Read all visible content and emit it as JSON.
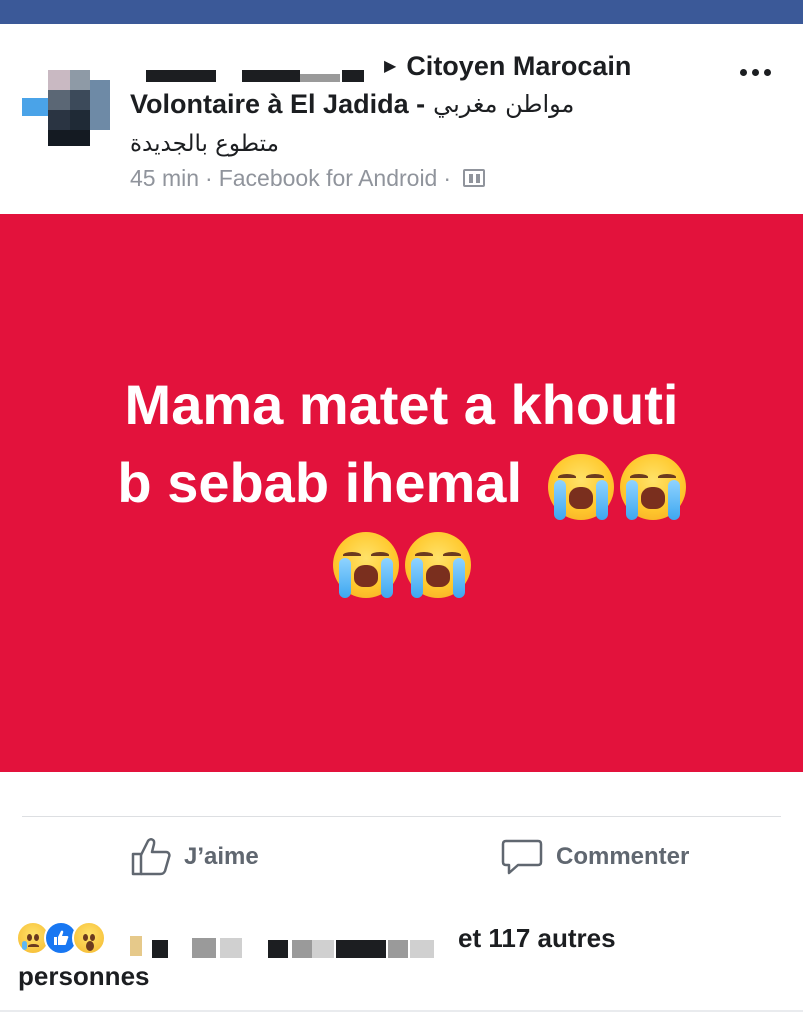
{
  "post": {
    "page_name": "Citoyen Marocain",
    "page_name_cont": "Volontaire à El Jadida -",
    "page_name_arabic_1": "مواطن مغربي",
    "page_name_arabic_2": "متطوع بالجديدة",
    "time": "45 min",
    "separator": "·",
    "source": "Facebook for Android",
    "text_line1": "Mama matet a khouti",
    "text_line2": "b sebab ihemal",
    "background_color": "#e3123c"
  },
  "actions": {
    "like_label": "J’aime",
    "comment_label": "Commenter"
  },
  "reactions": {
    "types": [
      "sad",
      "like",
      "wow"
    ],
    "summary": "et 117 autres",
    "summary_cont": "personnes"
  },
  "colors": {
    "topbar": "#3b5998",
    "meta_text": "#90949c",
    "action_text": "#606770"
  }
}
